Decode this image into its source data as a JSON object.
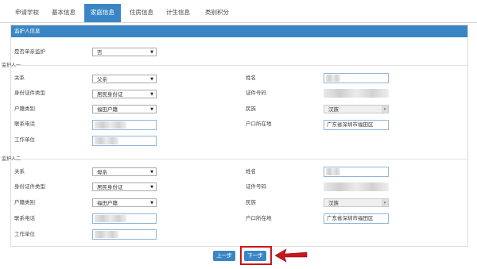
{
  "tabs": [
    {
      "label": "申请学校"
    },
    {
      "label": "基本信息"
    },
    {
      "label": "家庭信息"
    },
    {
      "label": "住房信息"
    },
    {
      "label": "计生信息"
    },
    {
      "label": "类别积分"
    }
  ],
  "panel": {
    "title": "监护人信息"
  },
  "single_parent": {
    "label": "是否单亲监护",
    "value": "否"
  },
  "guardian1": {
    "section_label": "监护人一",
    "relation_label": "关系",
    "relation": "父亲",
    "name_label": "姓名",
    "id_type_label": "身份证件类型",
    "id_type": "居民身份证",
    "id_no_label": "证件号码",
    "hukou_label": "户籍类别",
    "hukou": "福田户籍",
    "ethnic_label": "民族",
    "ethnic": "汉族",
    "phone_label": "联系电话",
    "hukou_loc_label": "户口所在地",
    "hukou_loc": "广东省深圳市福田区",
    "work_label": "工作单位"
  },
  "guardian2": {
    "section_label": "监护人二",
    "relation_label": "关系",
    "relation": "母亲",
    "name_label": "姓名",
    "id_type_label": "身份证件类型",
    "id_type": "居民身份证",
    "id_no_label": "证件号码",
    "hukou_label": "户籍类别",
    "hukou": "福田户籍",
    "ethnic_label": "民族",
    "ethnic": "汉族",
    "phone_label": "联系电话",
    "hukou_loc_label": "户口所在地",
    "hukou_loc": "广东省深圳市福田区",
    "work_label": "工作单位"
  },
  "buttons": {
    "prev": "上一步",
    "next": "下一步"
  },
  "colors": {
    "accent": "#3a86c5",
    "highlight": "#c8161d"
  }
}
